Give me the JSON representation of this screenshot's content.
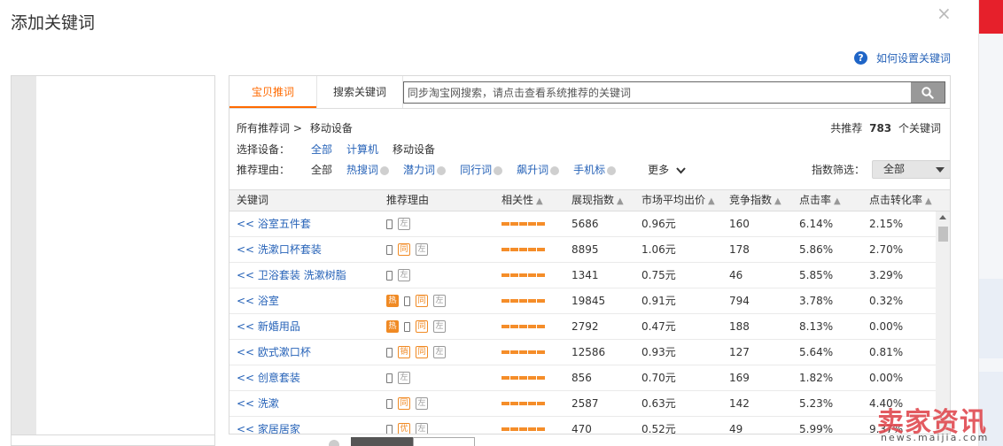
{
  "dialog": {
    "title": "添加关键词",
    "close_glyph": "×"
  },
  "help": {
    "icon": "question-circle-icon",
    "label": "如何设置关键词"
  },
  "tabs": [
    {
      "label": "宝贝推词",
      "active": true
    },
    {
      "label": "搜索关键词",
      "active": false
    }
  ],
  "search": {
    "placeholder": "同步淘宝网搜索，请点击查看系统推荐的关键词",
    "value": "",
    "icon": "search-icon"
  },
  "breadcrumb": {
    "root": "所有推荐词 >",
    "current": "移动设备"
  },
  "total": {
    "prefix": "共推荐",
    "count": "783",
    "suffix": "个关键词"
  },
  "devices": {
    "label": "选择设备：",
    "options": [
      {
        "label": "全部",
        "selected": false
      },
      {
        "label": "计算机",
        "selected": false
      },
      {
        "label": "移动设备",
        "selected": true
      }
    ]
  },
  "reasons_filter": {
    "label": "推荐理由：",
    "all": "全部",
    "options": [
      "热搜词",
      "潜力词",
      "同行词",
      "飙升词",
      "手机标"
    ],
    "more": "更多"
  },
  "index_filter": {
    "label": "指数筛选：",
    "value": "全部"
  },
  "columns": [
    "关键词",
    "推荐理由",
    "相关性",
    "展现指数",
    "市场平均出价",
    "竞争指数",
    "点击率",
    "点击转化率"
  ],
  "rows": [
    {
      "keyword": "<< 浴室五件套",
      "tags": [
        "左"
      ],
      "hot": false,
      "relevance": 5,
      "impressions": "5686",
      "avg_bid": "0.96元",
      "competition": "160",
      "ctr": "6.14%",
      "cvr": "2.15%"
    },
    {
      "keyword": "<< 洗漱口杯套装",
      "tags": [
        "同",
        "左"
      ],
      "hot": false,
      "relevance": 5,
      "impressions": "8895",
      "avg_bid": "1.06元",
      "competition": "178",
      "ctr": "5.86%",
      "cvr": "2.70%"
    },
    {
      "keyword": "<< 卫浴套装 洗漱树脂",
      "tags": [
        "左"
      ],
      "hot": false,
      "relevance": 5,
      "impressions": "1341",
      "avg_bid": "0.75元",
      "competition": "46",
      "ctr": "5.85%",
      "cvr": "3.29%"
    },
    {
      "keyword": "<< 浴室",
      "tags": [
        "同",
        "左"
      ],
      "hot": true,
      "relevance": 5,
      "impressions": "19845",
      "avg_bid": "0.91元",
      "competition": "794",
      "ctr": "3.78%",
      "cvr": "0.32%"
    },
    {
      "keyword": "<< 新婚用品",
      "tags": [
        "同",
        "左"
      ],
      "hot": true,
      "relevance": 5,
      "impressions": "2792",
      "avg_bid": "0.47元",
      "competition": "188",
      "ctr": "8.13%",
      "cvr": "0.00%"
    },
    {
      "keyword": "<< 欧式漱口杯",
      "tags": [
        "销",
        "同",
        "左"
      ],
      "hot": false,
      "relevance": 5,
      "impressions": "12586",
      "avg_bid": "0.93元",
      "competition": "127",
      "ctr": "5.64%",
      "cvr": "0.81%"
    },
    {
      "keyword": "<< 创意套装",
      "tags": [
        "左"
      ],
      "hot": false,
      "relevance": 5,
      "impressions": "856",
      "avg_bid": "0.70元",
      "competition": "169",
      "ctr": "1.82%",
      "cvr": "0.00%"
    },
    {
      "keyword": "<< 洗漱",
      "tags": [
        "同",
        "左"
      ],
      "hot": false,
      "relevance": 5,
      "impressions": "2587",
      "avg_bid": "0.63元",
      "competition": "142",
      "ctr": "5.23%",
      "cvr": "4.40%"
    },
    {
      "keyword": "<< 家居居家",
      "tags": [
        "优",
        "左"
      ],
      "hot": false,
      "relevance": 5,
      "impressions": "470",
      "avg_bid": "0.52元",
      "competition": "49",
      "ctr": "5.99%",
      "cvr": "9.37%"
    }
  ],
  "watermark": {
    "text": "卖家资讯",
    "url": "news.maijia.com"
  },
  "colors": {
    "accent": "#ff6a00",
    "link": "#2763b8",
    "relevance_bar": "#f58d29"
  }
}
